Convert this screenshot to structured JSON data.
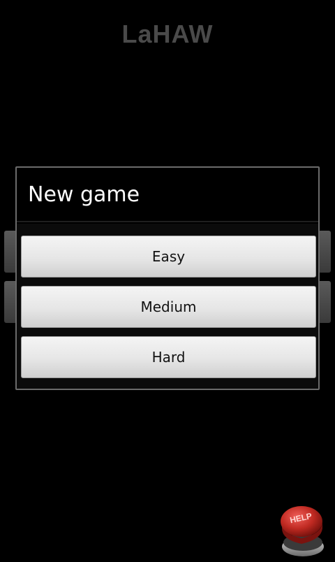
{
  "app": {
    "title": "LaHAW"
  },
  "dialog": {
    "title": "New game",
    "options": [
      "Easy",
      "Medium",
      "Hard"
    ]
  },
  "help_button": {
    "label": "HELP",
    "icon": "help-icon",
    "color": "#c02a22"
  }
}
